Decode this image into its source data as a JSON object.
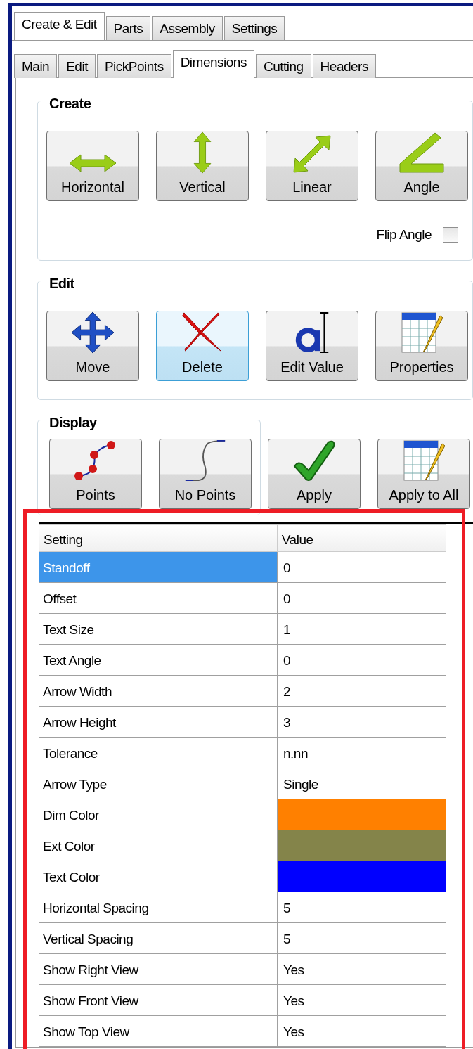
{
  "tabs": [
    {
      "label": "Create & Edit",
      "selected": true
    },
    {
      "label": "Parts",
      "selected": false
    },
    {
      "label": "Assembly",
      "selected": false
    },
    {
      "label": "Settings",
      "selected": false
    }
  ],
  "subtabs": [
    {
      "label": "Main",
      "selected": false
    },
    {
      "label": "Edit",
      "selected": false
    },
    {
      "label": "PickPoints",
      "selected": false
    },
    {
      "label": "Dimensions",
      "selected": true
    },
    {
      "label": "Cutting",
      "selected": false
    },
    {
      "label": "Headers",
      "selected": false
    }
  ],
  "groups": [
    {
      "title": "Create",
      "buttons": [
        {
          "label": "Horizontal",
          "focused": false
        },
        {
          "label": "Vertical",
          "focused": false
        },
        {
          "label": "Linear",
          "focused": false
        },
        {
          "label": "Angle",
          "focused": false
        }
      ],
      "flip_angle": {
        "label": "Flip Angle",
        "checked": false
      }
    },
    {
      "title": "Edit",
      "buttons": [
        {
          "label": "Move",
          "focused": false
        },
        {
          "label": "Delete",
          "focused": true
        },
        {
          "label": "Edit Value",
          "focused": false
        },
        {
          "label": "Properties",
          "focused": false
        }
      ]
    },
    {
      "title": "Display",
      "buttons": [
        {
          "label": "Points",
          "focused": false
        },
        {
          "label": "No Points",
          "focused": false
        }
      ]
    }
  ],
  "actions": [
    {
      "label": "Apply",
      "focused": false
    },
    {
      "label": "Apply to All",
      "focused": false
    }
  ],
  "grid": {
    "highlighted": true,
    "columns": [
      "Setting",
      "Value"
    ],
    "rows": [
      {
        "setting": "Standoff",
        "value": "0",
        "selected": true
      },
      {
        "setting": "Offset",
        "value": "0",
        "selected": false
      },
      {
        "setting": "Text Size",
        "value": "1",
        "selected": false
      },
      {
        "setting": "Text Angle",
        "value": "0",
        "selected": false
      },
      {
        "setting": "Arrow Width",
        "value": "2",
        "selected": false
      },
      {
        "setting": "Arrow Height",
        "value": "3",
        "selected": false
      },
      {
        "setting": "Tolerance",
        "value": "n.nn",
        "selected": false
      },
      {
        "setting": "Arrow Type",
        "value": "Single",
        "selected": false
      },
      {
        "setting": "Dim Color",
        "color": "#ff8000",
        "selected": false
      },
      {
        "setting": "Ext Color",
        "color": "#84844a",
        "selected": false
      },
      {
        "setting": "Text Color",
        "color": "#0000ff",
        "selected": false
      },
      {
        "setting": "Horizontal Spacing",
        "value": "5",
        "selected": false
      },
      {
        "setting": "Vertical Spacing",
        "value": "5",
        "selected": false
      },
      {
        "setting": "Show Right View",
        "value": "Yes",
        "selected": false
      },
      {
        "setting": "Show Front View",
        "value": "Yes",
        "selected": false
      },
      {
        "setting": "Show Top View",
        "value": "Yes",
        "selected": false
      }
    ]
  }
}
